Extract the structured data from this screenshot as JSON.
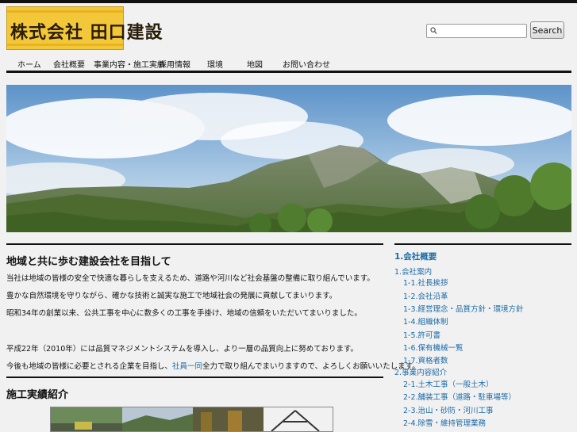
{
  "header": {
    "logo_text": "株式会社 田口建設",
    "search_placeholder": "",
    "search_button": "Search",
    "search_icon": "magnifier-icon"
  },
  "nav": {
    "items": [
      "ホーム",
      "会社概要",
      "事業内容・施工実績",
      "採用情報",
      "環境",
      "地図",
      "お問い合わせ"
    ]
  },
  "main": {
    "title": "地域と共に歩む建設会社を目指して",
    "paragraphs": [
      "当社は地域の皆様の安全で快適な暮らしを支えるため、道路や河川など社会基盤の整備に取り組んでいます。",
      "豊かな自然環境を守りながら、確かな技術と誠実な施工で地域社会の発展に貢献してまいります。",
      "昭和34年の創業以来、公共工事を中心に数多くの工事を手掛け、地域の信頼をいただいてまいりました。",
      "平成22年（2010年）には品質マネジメントシステムを導入し、より一層の品質向上に努めております。"
    ],
    "last_para_before": "今後も地域の皆様に必要とされる企業を目指し、",
    "last_para_link": "社員一同",
    "last_para_after": "全力で取り組んでまいりますので、よろしくお願いいたします。",
    "section_title": "施工実績紹介"
  },
  "sidebar": {
    "items": [
      {
        "label": "1.会社概要"
      },
      {
        "label": "1.会社案内"
      },
      {
        "label": "1-1.社長挨拶"
      },
      {
        "label": "1-2.会社沿革"
      },
      {
        "label": "1-3.経営理念・品質方針・環境方針"
      },
      {
        "label": "1-4.組織体制"
      },
      {
        "label": "1-5.許可書"
      },
      {
        "label": "1-6.保有機械一覧"
      },
      {
        "label": "1-7.資格者数"
      },
      {
        "label": "2.事業内容紹介"
      },
      {
        "label": "2-1.土木工事（一般土木）"
      },
      {
        "label": "2-2.舗装工事（道路・駐車場等）"
      },
      {
        "label": "2-3.治山・砂防・河川工事"
      },
      {
        "label": "2-4.除雪・維持管理業務"
      }
    ]
  },
  "colors": {
    "accent_link": "#1a6aa8",
    "logo_bg": "#f3c73a",
    "rule": "#111111"
  }
}
